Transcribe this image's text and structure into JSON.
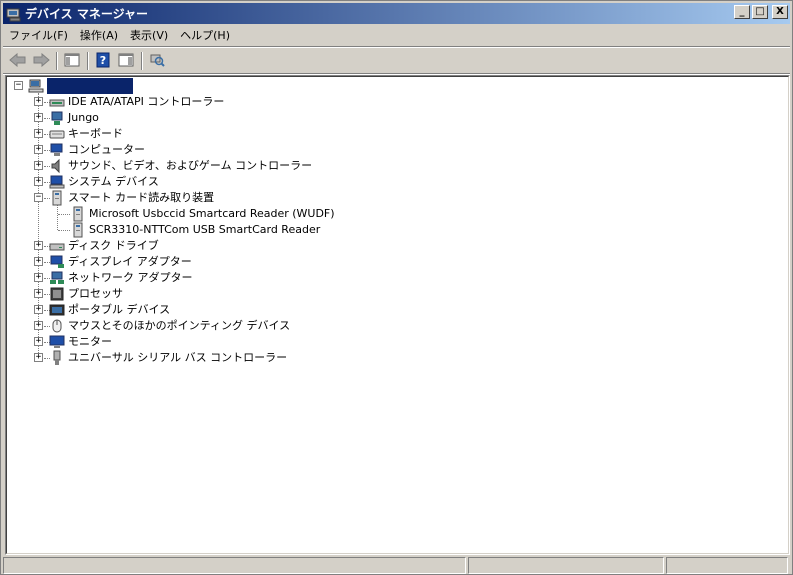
{
  "window": {
    "title": "デバイス マネージャー",
    "minimize": "_",
    "maximize": "□",
    "close": "X"
  },
  "menu": [
    {
      "label": "ファイル(F)"
    },
    {
      "label": "操作(A)"
    },
    {
      "label": "表示(V)"
    },
    {
      "label": "ヘルプ(H)"
    }
  ],
  "toolbar": {
    "back": "back-arrow-icon",
    "forward": "forward-arrow-icon",
    "console_tree": "console-tree-icon",
    "help": "help-icon",
    "properties": "properties-pane-icon",
    "scan": "scan-hardware-icon"
  },
  "tree": {
    "root_label": "",
    "root_expander": "−",
    "categories": [
      {
        "label": "IDE ATA/ATAPI コントローラー",
        "expander": "+",
        "icon": "ide-controller-icon"
      },
      {
        "label": "Jungo",
        "expander": "+",
        "icon": "jungo-icon"
      },
      {
        "label": "キーボード",
        "expander": "+",
        "icon": "keyboard-icon"
      },
      {
        "label": "コンピューター",
        "expander": "+",
        "icon": "computer-icon"
      },
      {
        "label": "サウンド、ビデオ、およびゲーム コントローラー",
        "expander": "+",
        "icon": "speaker-icon"
      },
      {
        "label": "システム デバイス",
        "expander": "+",
        "icon": "system-device-icon"
      },
      {
        "label": "スマート カード読み取り装置",
        "expander": "−",
        "icon": "smartcard-reader-icon",
        "children": [
          {
            "label": "Microsoft Usbccid Smartcard Reader (WUDF)",
            "icon": "smartcard-reader-icon"
          },
          {
            "label": "SCR3310-NTTCom USB SmartCard Reader",
            "icon": "smartcard-reader-icon"
          }
        ]
      },
      {
        "label": "ディスク ドライブ",
        "expander": "+",
        "icon": "disk-drive-icon"
      },
      {
        "label": "ディスプレイ アダプター",
        "expander": "+",
        "icon": "display-adapter-icon"
      },
      {
        "label": "ネットワーク アダプター",
        "expander": "+",
        "icon": "network-adapter-icon"
      },
      {
        "label": "プロセッサ",
        "expander": "+",
        "icon": "processor-icon"
      },
      {
        "label": "ポータブル デバイス",
        "expander": "+",
        "icon": "portable-device-icon"
      },
      {
        "label": "マウスとそのほかのポインティング デバイス",
        "expander": "+",
        "icon": "mouse-icon"
      },
      {
        "label": "モニター",
        "expander": "+",
        "icon": "monitor-icon"
      },
      {
        "label": "ユニバーサル シリアル バス コントローラー",
        "expander": "+",
        "icon": "usb-icon"
      }
    ]
  },
  "colors": {
    "title_start": "#0a246a",
    "title_end": "#a6caf0",
    "selection": "#0a246a",
    "chrome": "#d4d0c8"
  }
}
